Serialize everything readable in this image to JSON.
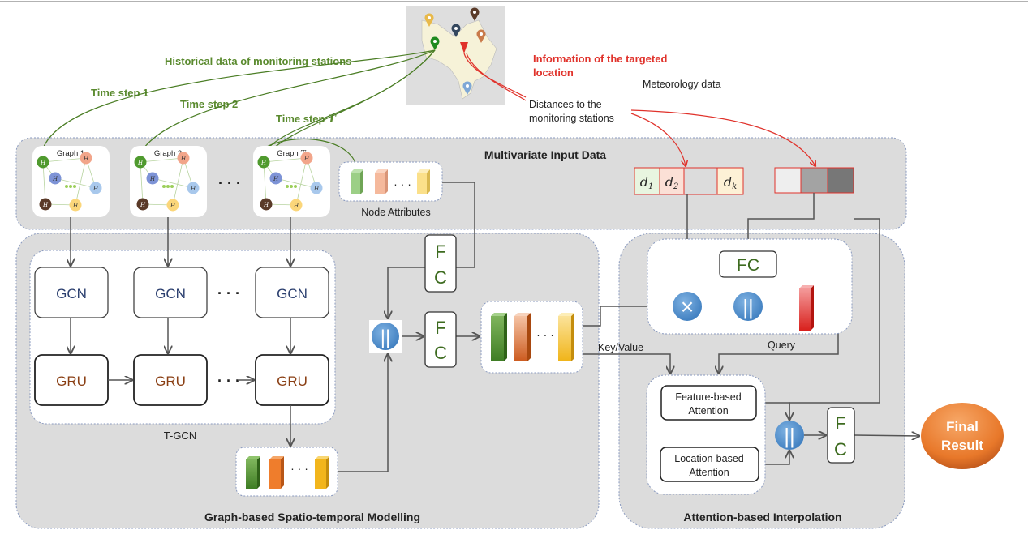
{
  "labels": {
    "historical": "Historical data of monitoring stations",
    "time_step_1": "Time step 1",
    "time_step_2": "Time step 2",
    "time_step_T": "Time step",
    "time_step_T_var": "T",
    "target_info_line1": "Information of the targeted",
    "target_info_line2": "location",
    "meteorology": "Meteorology data",
    "distances_line1": "Distances to the",
    "distances_line2": "monitoring stations"
  },
  "input_panel": {
    "title": "Multivariate Input Data",
    "graphs": [
      {
        "title": "Graph 1",
        "nodes": [
          "H",
          "H",
          "H",
          "H",
          "H",
          "H"
        ]
      },
      {
        "title": "Graph 2",
        "nodes": [
          "H",
          "H",
          "H",
          "H",
          "H",
          "H"
        ]
      },
      {
        "title": "Graph",
        "title_var": "T",
        "nodes": [
          "H",
          "H",
          "H",
          "H",
          "H",
          "H"
        ]
      }
    ],
    "ellipsis": "· · ·",
    "node_attributes": "Node Attributes",
    "distance_cells": [
      "d",
      "d",
      "",
      "d"
    ],
    "distance_subs": [
      "1",
      "2",
      "",
      "k"
    ]
  },
  "stgm_panel": {
    "title": "Graph-based Spatio-temporal Modelling",
    "tgcn_label": "T-GCN",
    "gcn": "GCN",
    "gru": "GRU",
    "fc_f": "F",
    "fc_c": "C",
    "concat": "||",
    "ellipsis": "· · ·"
  },
  "attn_panel": {
    "title": "Attention-based Interpolation",
    "fc": "FC",
    "multiply": "×",
    "concat": "||",
    "query": "Query",
    "key_value": "Key/Value",
    "feature_attn_1": "Feature-based",
    "feature_attn_2": "Attention",
    "location_attn_1": "Location-based",
    "location_attn_2": "Attention",
    "fc_f": "F",
    "fc_c": "C",
    "final_1": "Final",
    "final_2": "Result"
  },
  "colors": {
    "green_text": "#5a8a2e",
    "red_text": "#e0322b",
    "panel": "#dcdcdc",
    "circle_blue": "#4d8fcc",
    "final_orange": "#e8782a",
    "gcn_text": "#2a3e6e",
    "gru_text": "#8a3f14",
    "fc_text": "#3d6b1f"
  }
}
